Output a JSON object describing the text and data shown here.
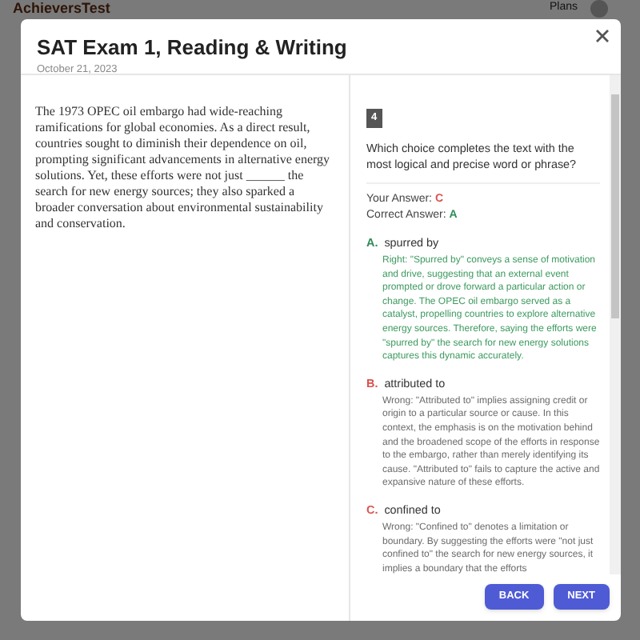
{
  "background": {
    "logo": "AchieversTest",
    "nav_link": "Plans"
  },
  "modal": {
    "title": "SAT Exam 1, Reading & Writing",
    "date": "October 21, 2023",
    "passage": "The 1973 OPEC oil embargo had wide-reaching ramifications for global economies. As a direct result, countries sought to diminish their dependence on oil, prompting significant advancements in alternative energy solutions. Yet, these efforts were not just ______ the search for new energy sources; they also sparked a broader conversation about environmental sustainability and conservation.",
    "question_number": "4",
    "question": "Which choice completes the text with the most logical and precise word or phrase?",
    "your_answer": {
      "label": "Your Answer:",
      "value": "C"
    },
    "correct_answer": {
      "label": "Correct Answer:",
      "value": "A"
    },
    "choices": [
      {
        "letter": "A.",
        "text": "spurred by",
        "kind": "correct",
        "explanation": "Right: \"Spurred by\" conveys a sense of motivation and drive, suggesting that an external event prompted or drove forward a particular action or change. The OPEC oil embargo served as a catalyst, propelling countries to explore alternative energy sources. Therefore, saying the efforts were \"spurred by\" the search for new energy solutions captures this dynamic accurately."
      },
      {
        "letter": "B.",
        "text": "attributed to",
        "kind": "wrong",
        "explanation": "Wrong: \"Attributed to\" implies assigning credit or origin to a particular source or cause. In this context, the emphasis is on the motivation behind and the broadened scope of the efforts in response to the embargo, rather than merely identifying its cause. \"Attributed to\" fails to capture the active and expansive nature of these efforts."
      },
      {
        "letter": "C.",
        "text": "confined to",
        "kind": "wrong",
        "explanation": "Wrong: \"Confined to\" denotes a limitation or boundary. By suggesting the efforts were \"not just confined to\" the search for new energy sources, it implies a boundary that the efforts"
      }
    ],
    "buttons": [
      "BACK",
      "NEXT"
    ]
  }
}
